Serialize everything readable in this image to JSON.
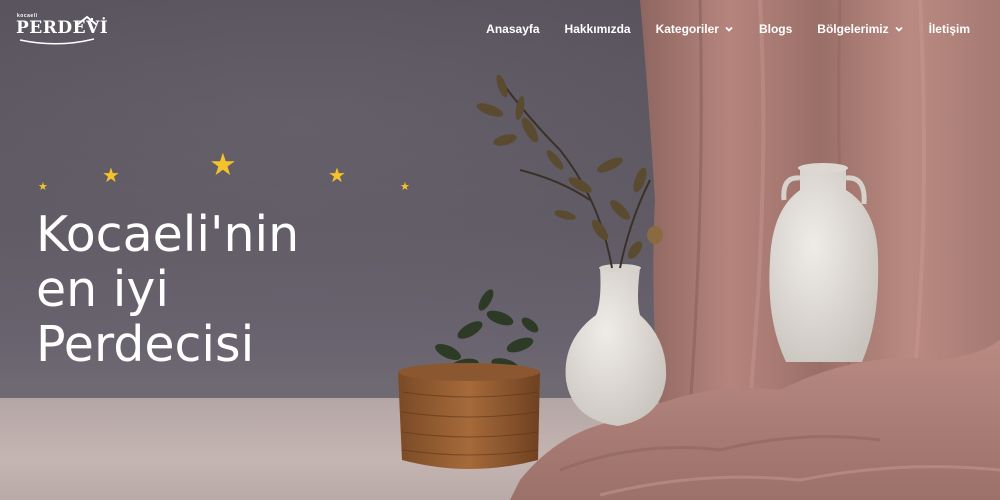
{
  "brand": {
    "small_text": "kocaeli",
    "name": "PERDEVİ"
  },
  "nav": {
    "items": [
      {
        "label": "Anasayfa",
        "dropdown": false
      },
      {
        "label": "Hakkımızda",
        "dropdown": false
      },
      {
        "label": "Kategoriler",
        "dropdown": true
      },
      {
        "label": "Blogs",
        "dropdown": false
      },
      {
        "label": "Bölgelerimiz",
        "dropdown": true
      },
      {
        "label": "İletişim",
        "dropdown": false
      }
    ]
  },
  "hero": {
    "line1": "Kocaeli'nin",
    "line2": "en iyi",
    "line3": "Perdecisi",
    "rating_stars": 5
  },
  "colors": {
    "star": "#f4c32a",
    "text": "#ffffff",
    "curtain": "#b07f78",
    "wall": "#5a5560"
  },
  "icons": {
    "dropdown": "chevron-down-icon",
    "star": "star-icon"
  }
}
